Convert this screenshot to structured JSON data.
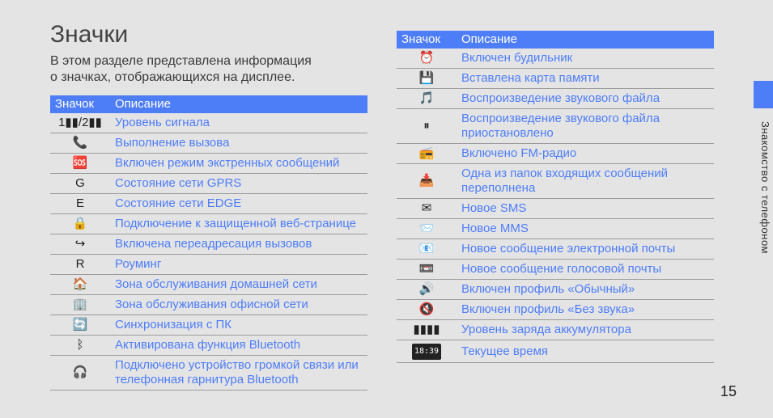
{
  "title": "Значки",
  "intro": "В этом разделе представлена информация о значках, отображающихся на дисплее.",
  "headers": {
    "icon": "Значок",
    "desc": "Описание"
  },
  "left": [
    {
      "iconName": "signal-icon",
      "glyph": "1▮▮/2▮▮",
      "desc": "Уровень сигнала"
    },
    {
      "iconName": "call-icon",
      "glyph": "📞",
      "desc": "Выполнение вызова"
    },
    {
      "iconName": "sos-icon",
      "glyph": "🆘",
      "desc": "Включен режим экстренных сообщений"
    },
    {
      "iconName": "gprs-icon",
      "glyph": "G",
      "desc": "Состояние сети GPRS"
    },
    {
      "iconName": "edge-icon",
      "glyph": "E",
      "desc": "Состояние сети EDGE"
    },
    {
      "iconName": "secure-web-icon",
      "glyph": "🔒",
      "desc": "Подключение к защищенной веб-странице"
    },
    {
      "iconName": "call-fwd-icon",
      "glyph": "↪",
      "desc": "Включена переадресация вызовов"
    },
    {
      "iconName": "roaming-icon",
      "glyph": "R",
      "desc": "Роуминг"
    },
    {
      "iconName": "home-icon",
      "glyph": "🏠",
      "desc": "Зона обслуживания домашней сети"
    },
    {
      "iconName": "office-icon",
      "glyph": "🏢",
      "desc": "Зона обслуживания офисной сети"
    },
    {
      "iconName": "sync-icon",
      "glyph": "🔄",
      "desc": "Синхронизация с ПК"
    },
    {
      "iconName": "bluetooth-icon",
      "glyph": "ᛒ",
      "desc": "Активирована функция Bluetooth"
    },
    {
      "iconName": "bt-audio-icon",
      "glyph": "🎧",
      "desc": "Подключено устройство громкой связи или телефонная гарнитура Bluetooth"
    }
  ],
  "right": [
    {
      "iconName": "alarm-icon",
      "glyph": "⏰",
      "desc": "Включен будильник"
    },
    {
      "iconName": "sdcard-icon",
      "glyph": "💾",
      "desc": "Вставлена карта памяти"
    },
    {
      "iconName": "audio-play-icon",
      "glyph": "🎵",
      "desc": "Воспроизведение звукового файла"
    },
    {
      "iconName": "audio-pause-icon",
      "glyph": "⏸",
      "desc": "Воспроизведение звукового файла приостановлено"
    },
    {
      "iconName": "fm-radio-icon",
      "glyph": "📻",
      "desc": "Включено FM-радио"
    },
    {
      "iconName": "inbox-full-icon",
      "glyph": "📥",
      "desc": "Одна из папок входящих сообщений переполнена"
    },
    {
      "iconName": "sms-icon",
      "glyph": "✉",
      "desc": "Новое SMS"
    },
    {
      "iconName": "mms-icon",
      "glyph": "📨",
      "desc": "Новое MMS"
    },
    {
      "iconName": "email-icon",
      "glyph": "📧",
      "desc": "Новое сообщение электронной почты"
    },
    {
      "iconName": "voicemail-icon",
      "glyph": "📼",
      "desc": "Новое сообщение голосовой почты"
    },
    {
      "iconName": "normal-prof-icon",
      "glyph": "🔊",
      "desc": "Включен профиль «Обычный»"
    },
    {
      "iconName": "silent-prof-icon",
      "glyph": "🔇",
      "desc": "Включен профиль «Без звука»"
    },
    {
      "iconName": "battery-icon",
      "glyph": "▮▮▮▮",
      "desc": "Уровень заряда аккумулятора"
    },
    {
      "iconName": "clock-icon",
      "glyph": "18:39",
      "isTime": true,
      "desc": "Текущее время"
    }
  ],
  "sideTab": "Знакомство с телефоном",
  "pageNumber": "15"
}
